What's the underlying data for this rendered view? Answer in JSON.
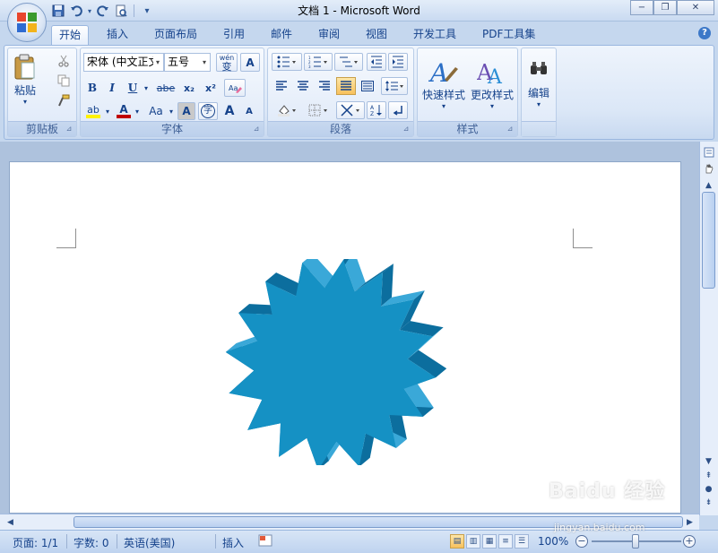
{
  "window": {
    "title": "文档 1 - Microsoft Word",
    "minimize": "−",
    "restore": "❐",
    "close": "✕"
  },
  "qat": {
    "save_icon": "save-icon",
    "undo_icon": "undo-icon",
    "redo_icon": "redo-icon",
    "preview_icon": "print-preview-icon",
    "customize": "▾"
  },
  "tabs": [
    {
      "label": "开始",
      "active": true
    },
    {
      "label": "插入"
    },
    {
      "label": "页面布局"
    },
    {
      "label": "引用"
    },
    {
      "label": "邮件"
    },
    {
      "label": "审阅"
    },
    {
      "label": "视图"
    },
    {
      "label": "开发工具"
    },
    {
      "label": "PDF工具集"
    }
  ],
  "help": "?",
  "ribbon": {
    "clipboard": {
      "label": "剪贴板",
      "paste": "粘贴"
    },
    "font": {
      "label": "字体",
      "font_name": "宋体 (中文正文)",
      "font_size": "五号",
      "wen": "wén",
      "wen_char": "变",
      "box_a": "A",
      "bold": "B",
      "italic": "I",
      "underline": "U",
      "strike": "abe",
      "sub": "x₂",
      "sup": "x²",
      "highlight": "ab",
      "font_color": "A",
      "case": "Aa",
      "shade_a": "A",
      "circle_char": "字",
      "grow": "A",
      "shrink": "A"
    },
    "paragraph": {
      "label": "段落"
    },
    "styles": {
      "label": "样式",
      "quick": "快速样式",
      "change": "更改样式"
    },
    "editing": {
      "label": "编辑",
      "title": "编辑"
    }
  },
  "status": {
    "page": "页面: 1/1",
    "words": "字数: 0",
    "language": "英语(美国)",
    "mode": "插入",
    "zoom": "100%",
    "zoom_minus": "−",
    "zoom_plus": "+"
  },
  "shape": {
    "fill": "#1591c4",
    "dark": "#0c6e9e",
    "light": "#3aa8d8"
  },
  "watermark": {
    "text": "Baidu 经验",
    "url": "jingyan.baidu.com"
  }
}
